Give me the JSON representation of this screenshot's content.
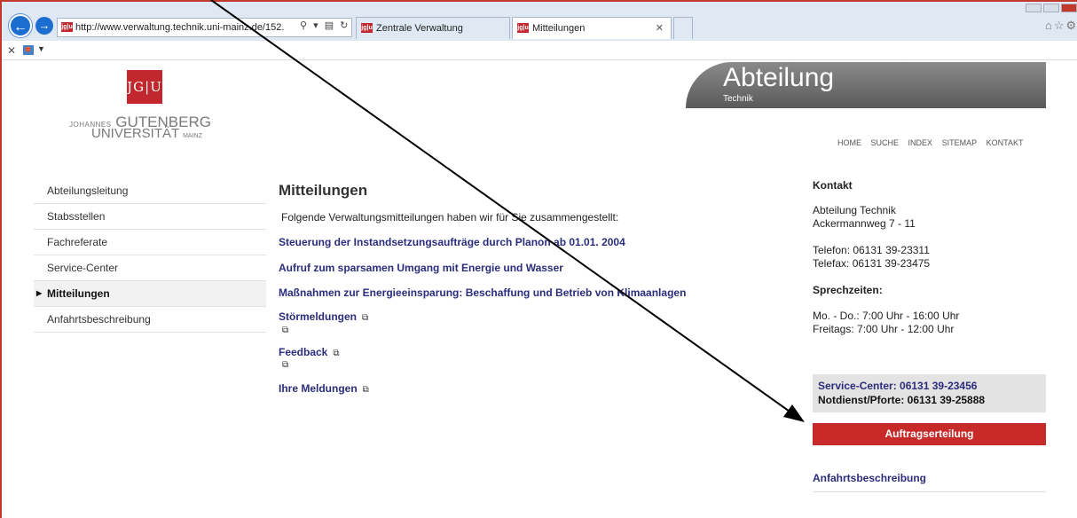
{
  "browser": {
    "url": "http://www.verwaltung.technik.uni-mainz.de/152.",
    "tabs": [
      {
        "label": "Zentrale Verwaltung",
        "active": false
      },
      {
        "label": "Mitteilungen",
        "active": true
      }
    ],
    "favicon_text": "jg|u",
    "accent": "#c1272d"
  },
  "logo": {
    "mark": "JG|U",
    "line1_small": "JOHANNES",
    "line1_big": "GUTENBERG",
    "line2_big": "UNIVERSITÄT",
    "line2_small": "MAINZ"
  },
  "header": {
    "title": "Abteilung",
    "subtitle": "Technik"
  },
  "top_nav": [
    "HOME",
    "SUCHE",
    "INDEX",
    "SITEMAP",
    "KONTAKT"
  ],
  "sidebar": {
    "items": [
      {
        "label": "Abteilungsleitung",
        "active": false
      },
      {
        "label": "Stabsstellen",
        "active": false
      },
      {
        "label": "Fachreferate",
        "active": false
      },
      {
        "label": "Service-Center",
        "active": false
      },
      {
        "label": "Mitteilungen",
        "active": true
      },
      {
        "label": "Anfahrtsbeschreibung",
        "active": false
      }
    ]
  },
  "main": {
    "title": "Mitteilungen",
    "intro": "Folgende Verwaltungsmitteilungen haben wir für Sie zusammengestellt:",
    "links": [
      "Steuerung der Instandsetzungsaufträge durch Planon ab 01.01. 2004",
      "Aufruf zum sparsamen Umgang mit Energie und Wasser",
      "Maßnahmen zur Energieeinsparung: Beschaffung und Betrieb von Klimaanlagen",
      "Störmeldungen",
      "Feedback",
      "Ihre Meldungen"
    ]
  },
  "contact": {
    "heading": "Kontakt",
    "dept": "Abteilung Technik",
    "street": "Ackermannweg 7 - 11",
    "phone": "Telefon: 06131 39-23311",
    "fax": "Telefax: 06131 39-23475",
    "hours_heading": "Sprechzeiten:",
    "hours1": "Mo. - Do.: 7:00 Uhr - 16:00 Uhr",
    "hours2": "Freitags:  7:00 Uhr - 12:00 Uhr",
    "service_center": "Service-Center:  06131 39-23456",
    "notdienst": "Notdienst/Pforte: 06131 39-25888",
    "auftrag_button": "Auftragserteilung",
    "anfahrt_link": "Anfahrtsbeschreibung"
  }
}
